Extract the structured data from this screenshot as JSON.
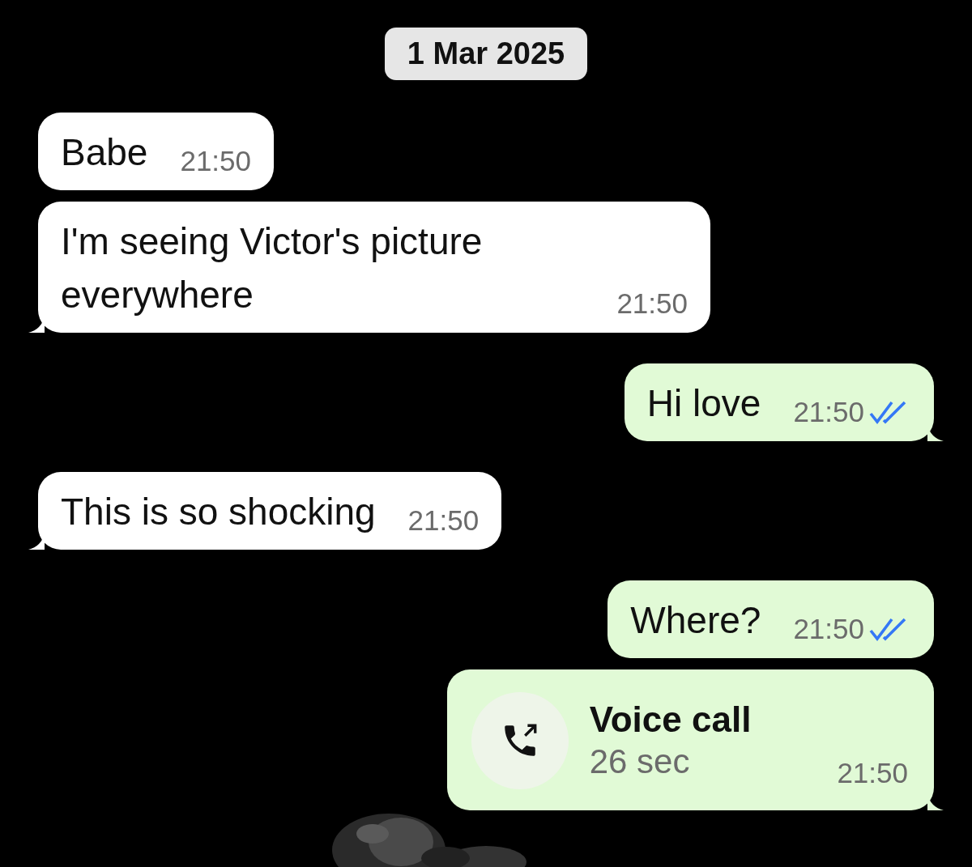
{
  "date_chip": "1 Mar 2025",
  "messages": [
    {
      "kind": "text",
      "outgoing": false,
      "tail": false,
      "text": "Babe",
      "time": "21:50"
    },
    {
      "kind": "text",
      "outgoing": false,
      "tail": true,
      "text": "I'm seeing Victor's picture everywhere",
      "time": "21:50"
    },
    {
      "kind": "text",
      "outgoing": true,
      "tail": true,
      "text": "Hi love",
      "time": "21:50",
      "read": true
    },
    {
      "kind": "text",
      "outgoing": false,
      "tail": true,
      "text": "This is so shocking",
      "time": "21:50"
    },
    {
      "kind": "text",
      "outgoing": true,
      "tail": false,
      "text": "Where?",
      "time": "21:50",
      "read": true
    },
    {
      "kind": "call",
      "outgoing": true,
      "tail": true,
      "title": "Voice call",
      "duration": "26 sec",
      "time": "21:50"
    }
  ]
}
